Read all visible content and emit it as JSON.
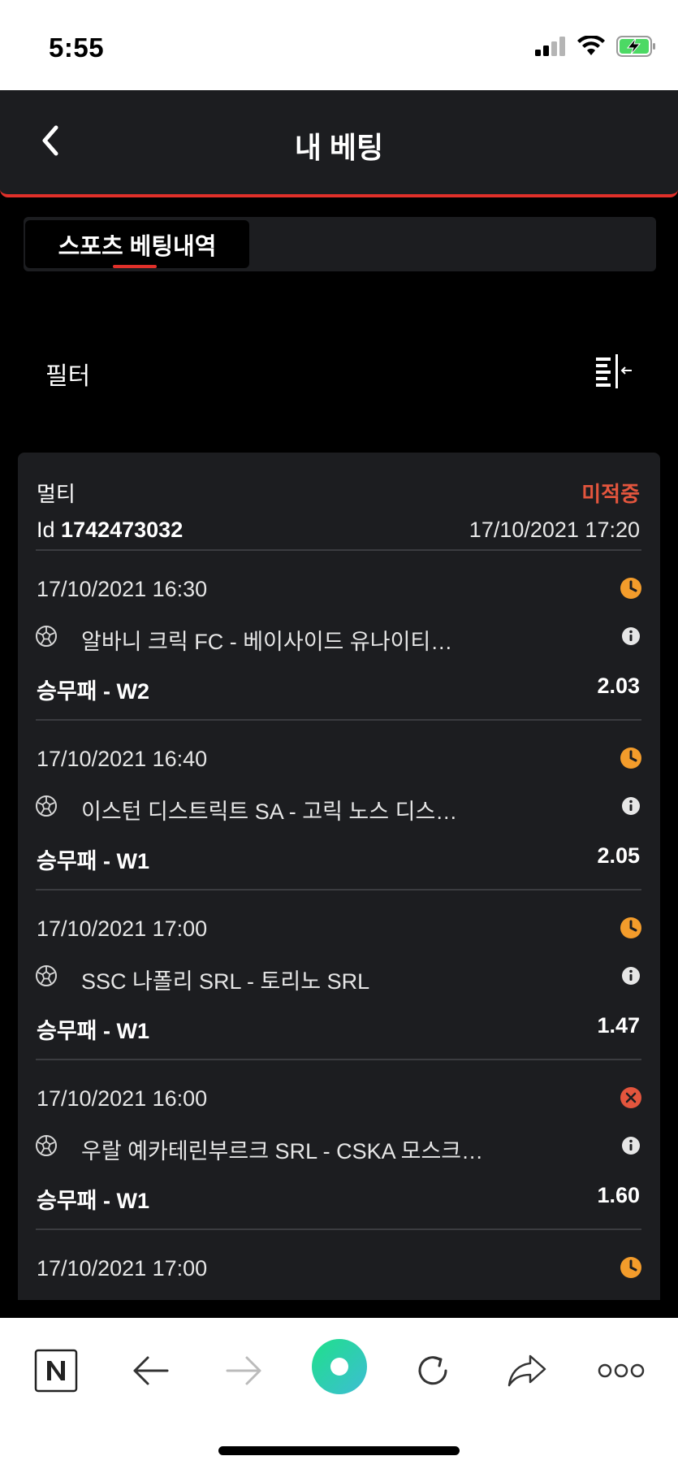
{
  "status_bar": {
    "time": "5:55"
  },
  "header": {
    "title": "내 베팅"
  },
  "tabs": [
    {
      "label": "스포츠 베팅내역"
    }
  ],
  "filter": {
    "label": "필터"
  },
  "bet": {
    "type": "멀티",
    "status": "미적중",
    "id_prefix": "Id",
    "id_value": "1742473032",
    "placed_at": "17/10/2021 17:20",
    "matches": [
      {
        "time": "17/10/2021 16:30",
        "teams": "알바니 크릭 FC - 베이사이드 유나이티…",
        "market": "승무패 - W2",
        "odds": "2.03",
        "status_icon": "clock-icon"
      },
      {
        "time": "17/10/2021 16:40",
        "teams": "이스턴 디스트릭트 SA - 고릭 노스 디스…",
        "market": "승무패 - W1",
        "odds": "2.05",
        "status_icon": "clock-icon"
      },
      {
        "time": "17/10/2021 17:00",
        "teams": "SSC 나폴리 SRL - 토리노 SRL",
        "market": "승무패 - W1",
        "odds": "1.47",
        "status_icon": "clock-icon"
      },
      {
        "time": "17/10/2021 16:00",
        "teams": "우랄 예카테린부르크 SRL - CSKA 모스크…",
        "market": "승무패 - W1",
        "odds": "1.60",
        "status_icon": "x-circle-icon"
      },
      {
        "time": "17/10/2021 17:00",
        "status_icon": "clock-icon"
      }
    ]
  },
  "colors": {
    "accent": "#e0302a",
    "lost": "#e3553d",
    "pending": "#f39c2b",
    "card": "#1c1d20"
  }
}
